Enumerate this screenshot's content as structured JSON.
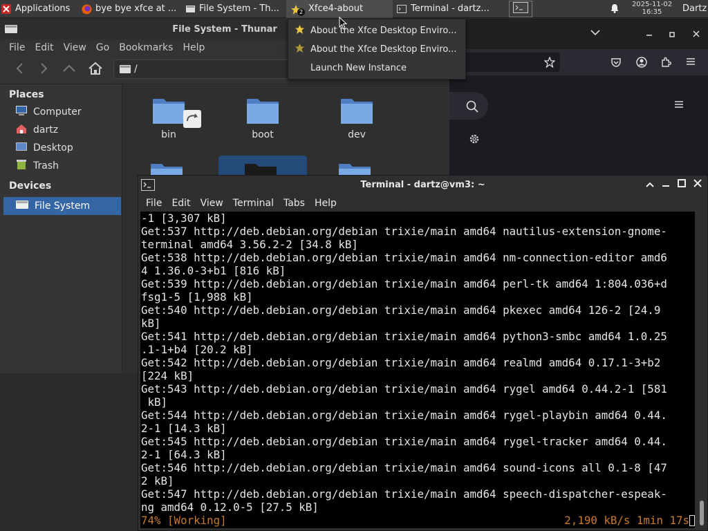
{
  "panel": {
    "tasks": [
      {
        "label": "Applications",
        "icon": "xfce-menu-icon"
      },
      {
        "label": "bye bye xfce at ...",
        "icon": "firefox-icon"
      },
      {
        "label": "File System - Th...",
        "icon": "file-manager-icon"
      },
      {
        "label": "Xfce4-about",
        "icon": "star-icon",
        "badge": "2"
      },
      {
        "label": "Terminal - dartz...",
        "icon": "terminal-icon"
      }
    ],
    "clock_date": "2025-11-02",
    "clock_time": "16:35",
    "user": "Dartz"
  },
  "task_menu": {
    "items": [
      {
        "label": "About the Xfce Desktop Enviro...",
        "icon": "star-icon"
      },
      {
        "label": "About the Xfce Desktop Enviro...",
        "icon": "star-icon"
      },
      {
        "label": "Launch New Instance"
      }
    ]
  },
  "thunar": {
    "title": "File System - Thunar",
    "menu": [
      "File",
      "Edit",
      "View",
      "Go",
      "Bookmarks",
      "Help"
    ],
    "path": "/",
    "places_header": "Places",
    "places": [
      {
        "label": "Computer",
        "icon": "computer-icon"
      },
      {
        "label": "dartz",
        "icon": "home-folder-icon"
      },
      {
        "label": "Desktop",
        "icon": "desktop-icon"
      },
      {
        "label": "Trash",
        "icon": "trash-icon"
      }
    ],
    "devices_header": "Devices",
    "devices": [
      {
        "label": "File System",
        "icon": "drive-icon",
        "selected": true
      }
    ],
    "files": [
      "bin",
      "boot",
      "dev"
    ]
  },
  "terminal": {
    "title": "Terminal - dartz@vm3: ~",
    "menu": [
      "File",
      "Edit",
      "View",
      "Terminal",
      "Tabs",
      "Help"
    ],
    "lines": [
      "-1 [3,307 kB]",
      "Get:537 http://deb.debian.org/debian trixie/main amd64 nautilus-extension-gnome-",
      "terminal amd64 3.56.2-2 [34.8 kB]",
      "Get:538 http://deb.debian.org/debian trixie/main amd64 nm-connection-editor amd6",
      "4 1.36.0-3+b1 [816 kB]",
      "Get:539 http://deb.debian.org/debian trixie/main amd64 perl-tk amd64 1:804.036+d",
      "fsg1-5 [1,988 kB]",
      "Get:540 http://deb.debian.org/debian trixie/main amd64 pkexec amd64 126-2 [24.9",
      "kB]",
      "Get:541 http://deb.debian.org/debian trixie/main amd64 python3-smbc amd64 1.0.25",
      ".1-1+b4 [20.2 kB]",
      "Get:542 http://deb.debian.org/debian trixie/main amd64 realmd amd64 0.17.1-3+b2",
      "[224 kB]",
      "Get:543 http://deb.debian.org/debian trixie/main amd64 rygel amd64 0.44.2-1 [581",
      " kB]",
      "Get:544 http://deb.debian.org/debian trixie/main amd64 rygel-playbin amd64 0.44.",
      "2-1 [14.3 kB]",
      "Get:545 http://deb.debian.org/debian trixie/main amd64 rygel-tracker amd64 0.44.",
      "2-1 [64.3 kB]",
      "Get:546 http://deb.debian.org/debian trixie/main amd64 sound-icons all 0.1-8 [47",
      "2 kB]",
      "Get:547 http://deb.debian.org/debian trixie/main amd64 speech-dispatcher-espeak-",
      "ng amd64 0.12.0-5 [27.5 kB]"
    ],
    "status_left": "74% [Working]",
    "status_right": "2,190 kB/s 1min 17s"
  },
  "colors": {
    "selection": "#3465a4",
    "status_text": "#c87a2a",
    "terminal_bg": "#000000",
    "folder_blue": "#6fa3e0"
  }
}
